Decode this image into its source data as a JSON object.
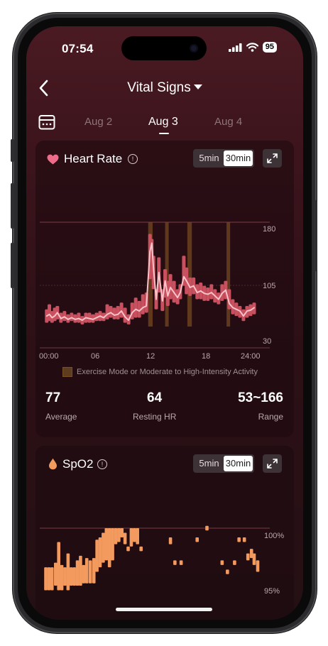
{
  "status_bar": {
    "time": "07:54",
    "battery": "95"
  },
  "nav": {
    "title": "Vital Signs"
  },
  "dates": {
    "prev": "Aug 2",
    "current": "Aug 3",
    "next": "Aug 4"
  },
  "heart_rate": {
    "title": "Heart Rate",
    "info": "!",
    "interval_options": [
      "5min",
      "30min"
    ],
    "selected_interval": "30min",
    "legend": "Exercise Mode or Moderate to High-Intensity Activity",
    "stats": [
      {
        "value": "77",
        "label": "Average"
      },
      {
        "value": "64",
        "label": "Resting HR"
      },
      {
        "value": "53~166",
        "label": "Range"
      }
    ],
    "colors": {
      "line": "#f7c3c8",
      "range_bar": "#c9505f",
      "exercise": "#6b421f",
      "gridline": "#7d3a44"
    },
    "chart_data": {
      "type": "line",
      "y_ticks": [
        "180",
        "105",
        "30"
      ],
      "x_ticks": [
        "00:00",
        "06",
        "12",
        "18",
        "24:00"
      ],
      "ylim": [
        30,
        180
      ],
      "xlim": [
        0,
        24
      ],
      "exercise_periods": [
        [
          11.7,
          12.2
        ],
        [
          13.6,
          14.0
        ],
        [
          16.1,
          16.6
        ],
        [
          20.5,
          20.9
        ]
      ],
      "avg": [
        [
          0.3,
          68
        ],
        [
          0.6,
          70
        ],
        [
          0.9,
          66
        ],
        [
          1.2,
          68
        ],
        [
          1.5,
          72
        ],
        [
          1.9,
          65
        ],
        [
          2.3,
          67
        ],
        [
          2.7,
          64
        ],
        [
          3.1,
          66
        ],
        [
          3.5,
          64
        ],
        [
          3.9,
          65
        ],
        [
          4.3,
          63
        ],
        [
          4.7,
          66
        ],
        [
          5.1,
          65
        ],
        [
          5.5,
          64
        ],
        [
          5.9,
          66
        ],
        [
          6.3,
          68
        ],
        [
          6.7,
          66
        ],
        [
          7.1,
          70
        ],
        [
          7.5,
          72
        ],
        [
          7.9,
          69
        ],
        [
          8.3,
          70
        ],
        [
          8.7,
          74
        ],
        [
          9.1,
          67
        ],
        [
          9.5,
          63
        ],
        [
          9.9,
          72
        ],
        [
          10.3,
          76
        ],
        [
          10.7,
          74
        ],
        [
          11.1,
          78
        ],
        [
          11.5,
          80
        ],
        [
          11.9,
          145
        ],
        [
          12.1,
          155
        ],
        [
          12.3,
          124
        ],
        [
          12.6,
          88
        ],
        [
          12.9,
          120
        ],
        [
          13.3,
          86
        ],
        [
          13.6,
          110
        ],
        [
          13.9,
          92
        ],
        [
          14.2,
          102
        ],
        [
          14.6,
          96
        ],
        [
          15.0,
          90
        ],
        [
          15.3,
          96
        ],
        [
          15.7,
          115
        ],
        [
          16.0,
          110
        ],
        [
          16.4,
          102
        ],
        [
          16.8,
          104
        ],
        [
          17.2,
          96
        ],
        [
          17.6,
          98
        ],
        [
          18.0,
          95
        ],
        [
          18.4,
          94
        ],
        [
          18.8,
          96
        ],
        [
          19.2,
          92
        ],
        [
          19.6,
          88
        ],
        [
          20.0,
          95
        ],
        [
          20.4,
          99
        ],
        [
          20.8,
          83
        ],
        [
          21.2,
          78
        ],
        [
          21.6,
          76
        ],
        [
          22.0,
          74
        ],
        [
          22.4,
          68
        ],
        [
          22.8,
          74
        ],
        [
          23.2,
          75
        ],
        [
          23.6,
          78
        ]
      ],
      "ranges": [
        [
          0.3,
          60,
          76
        ],
        [
          0.6,
          62,
          82
        ],
        [
          0.9,
          60,
          74
        ],
        [
          1.2,
          62,
          78
        ],
        [
          1.5,
          64,
          80
        ],
        [
          1.9,
          60,
          72
        ],
        [
          2.3,
          62,
          74
        ],
        [
          2.7,
          60,
          70
        ],
        [
          3.1,
          62,
          72
        ],
        [
          3.5,
          60,
          70
        ],
        [
          3.9,
          60,
          72
        ],
        [
          4.3,
          58,
          68
        ],
        [
          4.7,
          60,
          72
        ],
        [
          5.1,
          60,
          72
        ],
        [
          5.5,
          60,
          70
        ],
        [
          5.9,
          62,
          72
        ],
        [
          6.3,
          62,
          74
        ],
        [
          6.7,
          62,
          72
        ],
        [
          7.1,
          64,
          82
        ],
        [
          7.5,
          66,
          80
        ],
        [
          7.9,
          64,
          78
        ],
        [
          8.3,
          64,
          80
        ],
        [
          8.7,
          66,
          84
        ],
        [
          9.1,
          60,
          78
        ],
        [
          9.5,
          58,
          70
        ],
        [
          9.9,
          64,
          84
        ],
        [
          10.3,
          66,
          90
        ],
        [
          10.7,
          66,
          86
        ],
        [
          11.1,
          70,
          94
        ],
        [
          11.5,
          72,
          96
        ],
        [
          11.9,
          112,
          166
        ],
        [
          12.1,
          120,
          160
        ],
        [
          12.3,
          100,
          140
        ],
        [
          12.6,
          76,
          100
        ],
        [
          12.9,
          96,
          138
        ],
        [
          13.3,
          74,
          100
        ],
        [
          13.6,
          90,
          124
        ],
        [
          13.9,
          80,
          110
        ],
        [
          14.2,
          88,
          118
        ],
        [
          14.6,
          84,
          110
        ],
        [
          15.0,
          82,
          100
        ],
        [
          15.3,
          88,
          106
        ],
        [
          15.7,
          104,
          140
        ],
        [
          16.0,
          94,
          126
        ],
        [
          16.4,
          92,
          114
        ],
        [
          16.8,
          94,
          114
        ],
        [
          17.2,
          88,
          106
        ],
        [
          17.6,
          88,
          108
        ],
        [
          18.0,
          86,
          104
        ],
        [
          18.4,
          86,
          102
        ],
        [
          18.8,
          88,
          106
        ],
        [
          19.2,
          84,
          100
        ],
        [
          19.6,
          82,
          96
        ],
        [
          20.0,
          86,
          106
        ],
        [
          20.4,
          88,
          110
        ],
        [
          20.8,
          76,
          100
        ],
        [
          21.2,
          70,
          88
        ],
        [
          21.6,
          68,
          84
        ],
        [
          22.0,
          66,
          80
        ],
        [
          22.4,
          62,
          76
        ],
        [
          22.8,
          66,
          80
        ],
        [
          23.2,
          68,
          82
        ],
        [
          23.6,
          70,
          84
        ]
      ]
    }
  },
  "spo2": {
    "title": "SpO2",
    "info": "!",
    "interval_options": [
      "5min",
      "30min"
    ],
    "selected_interval": "30min",
    "colors": {
      "bar": "#f39a5e",
      "gridline": "#7d3a44"
    },
    "chart_data": {
      "type": "bar",
      "y_ticks": [
        "100%",
        "95%"
      ],
      "ylim": [
        95,
        100
      ],
      "bars": [
        [
          0.2,
          94.6,
          96.6
        ],
        [
          0.55,
          94.6,
          96.6
        ],
        [
          0.9,
          94.6,
          96.6
        ],
        [
          1.3,
          95.0,
          97.0
        ],
        [
          1.65,
          94.6,
          98.8
        ],
        [
          2.0,
          94.6,
          96.8
        ],
        [
          2.35,
          95.0,
          96.6
        ],
        [
          2.7,
          94.6,
          97.8
        ],
        [
          3.05,
          95.0,
          96.6
        ],
        [
          3.4,
          95.0,
          96.6
        ],
        [
          3.75,
          95.0,
          97.2
        ],
        [
          4.1,
          95.0,
          97.6
        ],
        [
          4.45,
          95.2,
          96.8
        ],
        [
          4.8,
          95.2,
          97.4
        ],
        [
          5.2,
          95.2,
          97.2
        ],
        [
          5.6,
          95.2,
          97.4
        ],
        [
          5.95,
          96.2,
          99.0
        ],
        [
          6.3,
          96.6,
          99.2
        ],
        [
          6.65,
          97.0,
          99.6
        ],
        [
          7.0,
          97.2,
          100.0
        ],
        [
          7.35,
          96.6,
          100.0
        ],
        [
          7.7,
          97.2,
          100.0
        ],
        [
          8.05,
          98.6,
          100.0
        ],
        [
          8.4,
          98.8,
          100.0
        ],
        [
          8.75,
          99.2,
          100.0
        ],
        [
          9.1,
          98.6,
          99.6
        ],
        [
          9.45,
          98.0,
          98.4
        ],
        [
          9.8,
          98.4,
          100.0
        ],
        [
          10.15,
          98.8,
          100.0
        ],
        [
          10.5,
          98.6,
          100.0
        ],
        [
          10.9,
          98.0,
          98.4
        ],
        [
          14.2,
          98.6,
          99.2
        ],
        [
          14.7,
          96.8,
          97.2
        ],
        [
          15.4,
          96.8,
          97.2
        ],
        [
          17.2,
          98.8,
          99.2
        ],
        [
          18.3,
          99.8,
          100.2
        ],
        [
          20.0,
          96.8,
          97.2
        ],
        [
          20.6,
          96.0,
          96.4
        ],
        [
          21.4,
          96.8,
          97.2
        ],
        [
          21.9,
          98.8,
          99.2
        ],
        [
          22.5,
          98.8,
          99.2
        ],
        [
          22.9,
          97.2,
          97.8
        ],
        [
          23.3,
          97.4,
          98.2
        ],
        [
          23.6,
          96.8,
          97.8
        ],
        [
          24.0,
          96.2,
          97.2
        ]
      ]
    }
  }
}
